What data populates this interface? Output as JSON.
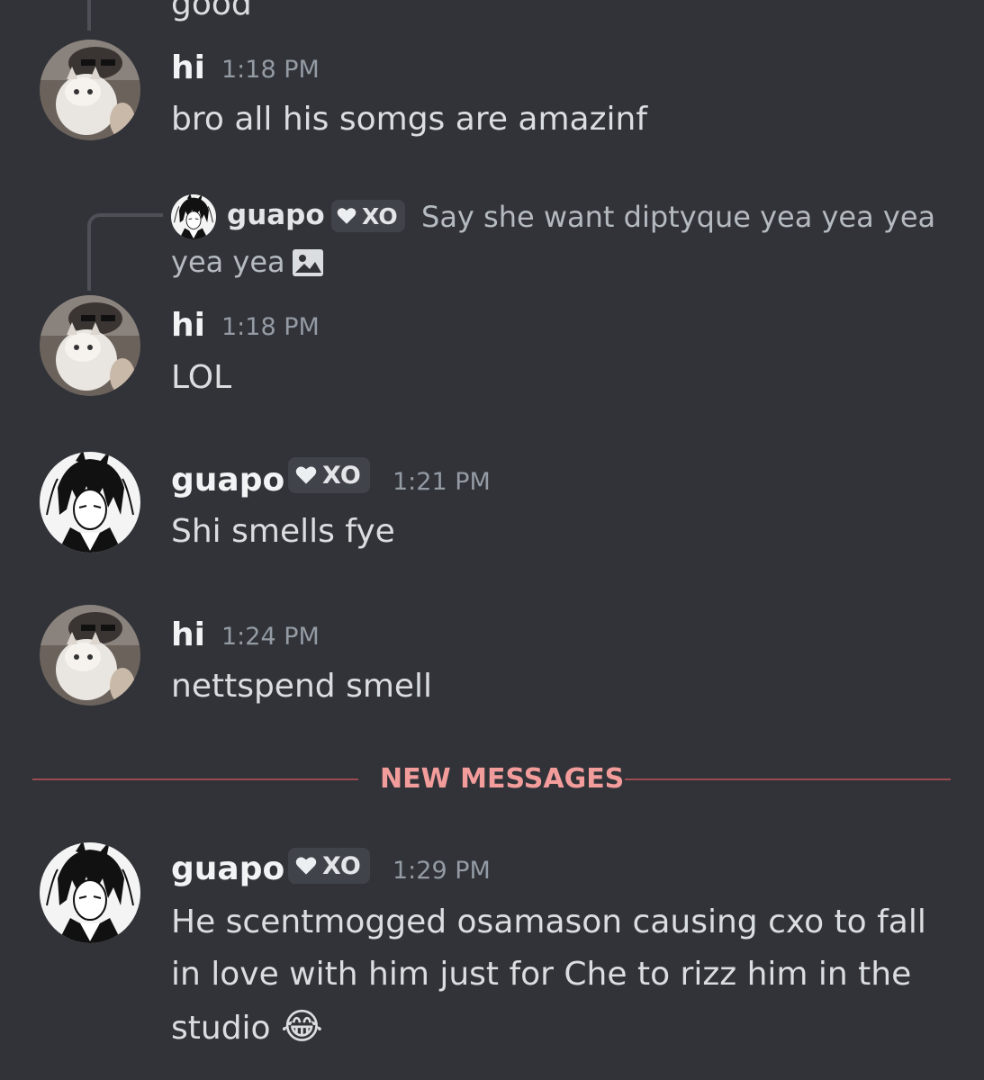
{
  "colors": {
    "background": "#313338",
    "new_messages": "#f39c9c",
    "divider": "#9b4a50"
  },
  "prev_message_tail": "good",
  "messages": [
    {
      "author": "hi",
      "time": "1:18 PM",
      "text": "bro all his somgs are amazinf",
      "avatar": "cat-avatar-icon"
    },
    {
      "reply": {
        "author": "guapo",
        "tag": "XO",
        "preview": "Say she want diptyque yea yea yea",
        "preview_line2": "yea yea",
        "attachment_icon": "image-icon"
      },
      "author": "hi",
      "time": "1:18 PM",
      "text": "LOL",
      "avatar": "cat-avatar-icon"
    },
    {
      "author": "guapo",
      "tag": "XO",
      "time": "1:21 PM",
      "text": "Shi smells fye",
      "avatar": "anime-avatar-icon"
    },
    {
      "author": "hi",
      "time": "1:24 PM",
      "text": "nettspend smell",
      "avatar": "cat-avatar-icon"
    },
    {
      "author": "guapo",
      "tag": "XO",
      "time": "1:29 PM",
      "text": "He scentmogged osamason causing cxo to fall in love with him just for Che to rizz him in the studio",
      "emoji": "😂",
      "avatar": "anime-avatar-icon"
    }
  ],
  "divider": {
    "label": "NEW MESSAGES"
  }
}
